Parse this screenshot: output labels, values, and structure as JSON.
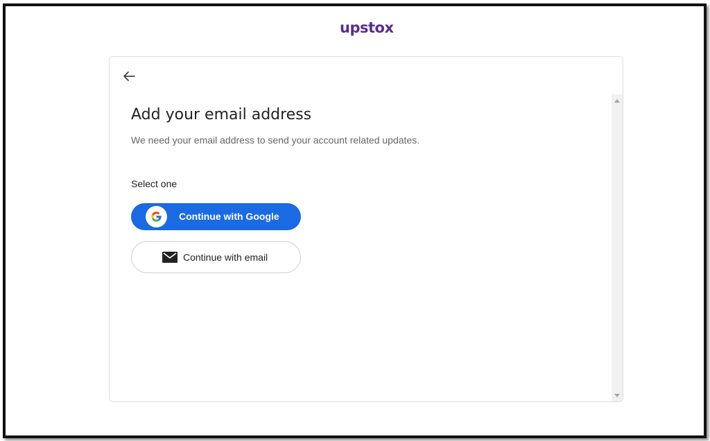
{
  "brand": {
    "logo_text": "upstox",
    "color": "#5a2d91"
  },
  "card": {
    "back_icon": "arrow-left-icon",
    "title": "Add your email address",
    "subtitle": "We need your email address to send your account related updates.",
    "select_label": "Select one",
    "google_button": {
      "label": "Continue with Google",
      "icon": "google-icon",
      "color": "#1a6ae3"
    },
    "email_button": {
      "label": "Continue with email",
      "icon": "envelope-icon"
    }
  }
}
